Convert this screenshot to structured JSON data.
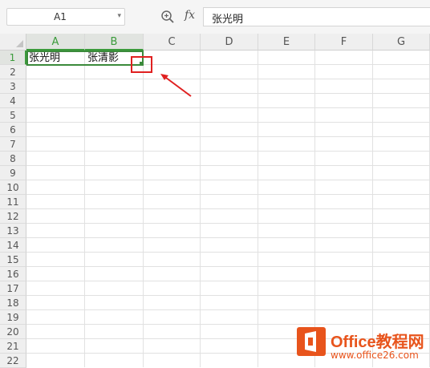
{
  "formula_bar": {
    "name_box": "A1",
    "fx_label": "fx",
    "content": "张光明"
  },
  "columns": [
    "A",
    "B",
    "C",
    "D",
    "E",
    "F",
    "G"
  ],
  "rows": [
    "1",
    "2",
    "3",
    "4",
    "5",
    "6",
    "7",
    "8",
    "9",
    "10",
    "11",
    "12",
    "13",
    "14",
    "15",
    "16",
    "17",
    "18",
    "19",
    "20",
    "21",
    "22"
  ],
  "cells": {
    "A1": "张光明",
    "B1": "张清影"
  },
  "selected_range": "A1:B1",
  "watermark": {
    "title": "Office教程网",
    "subtitle": "www.office26.com"
  },
  "colors": {
    "selection": "#3b8a3b",
    "annotation": "#e02020",
    "watermark": "#e8541c"
  }
}
